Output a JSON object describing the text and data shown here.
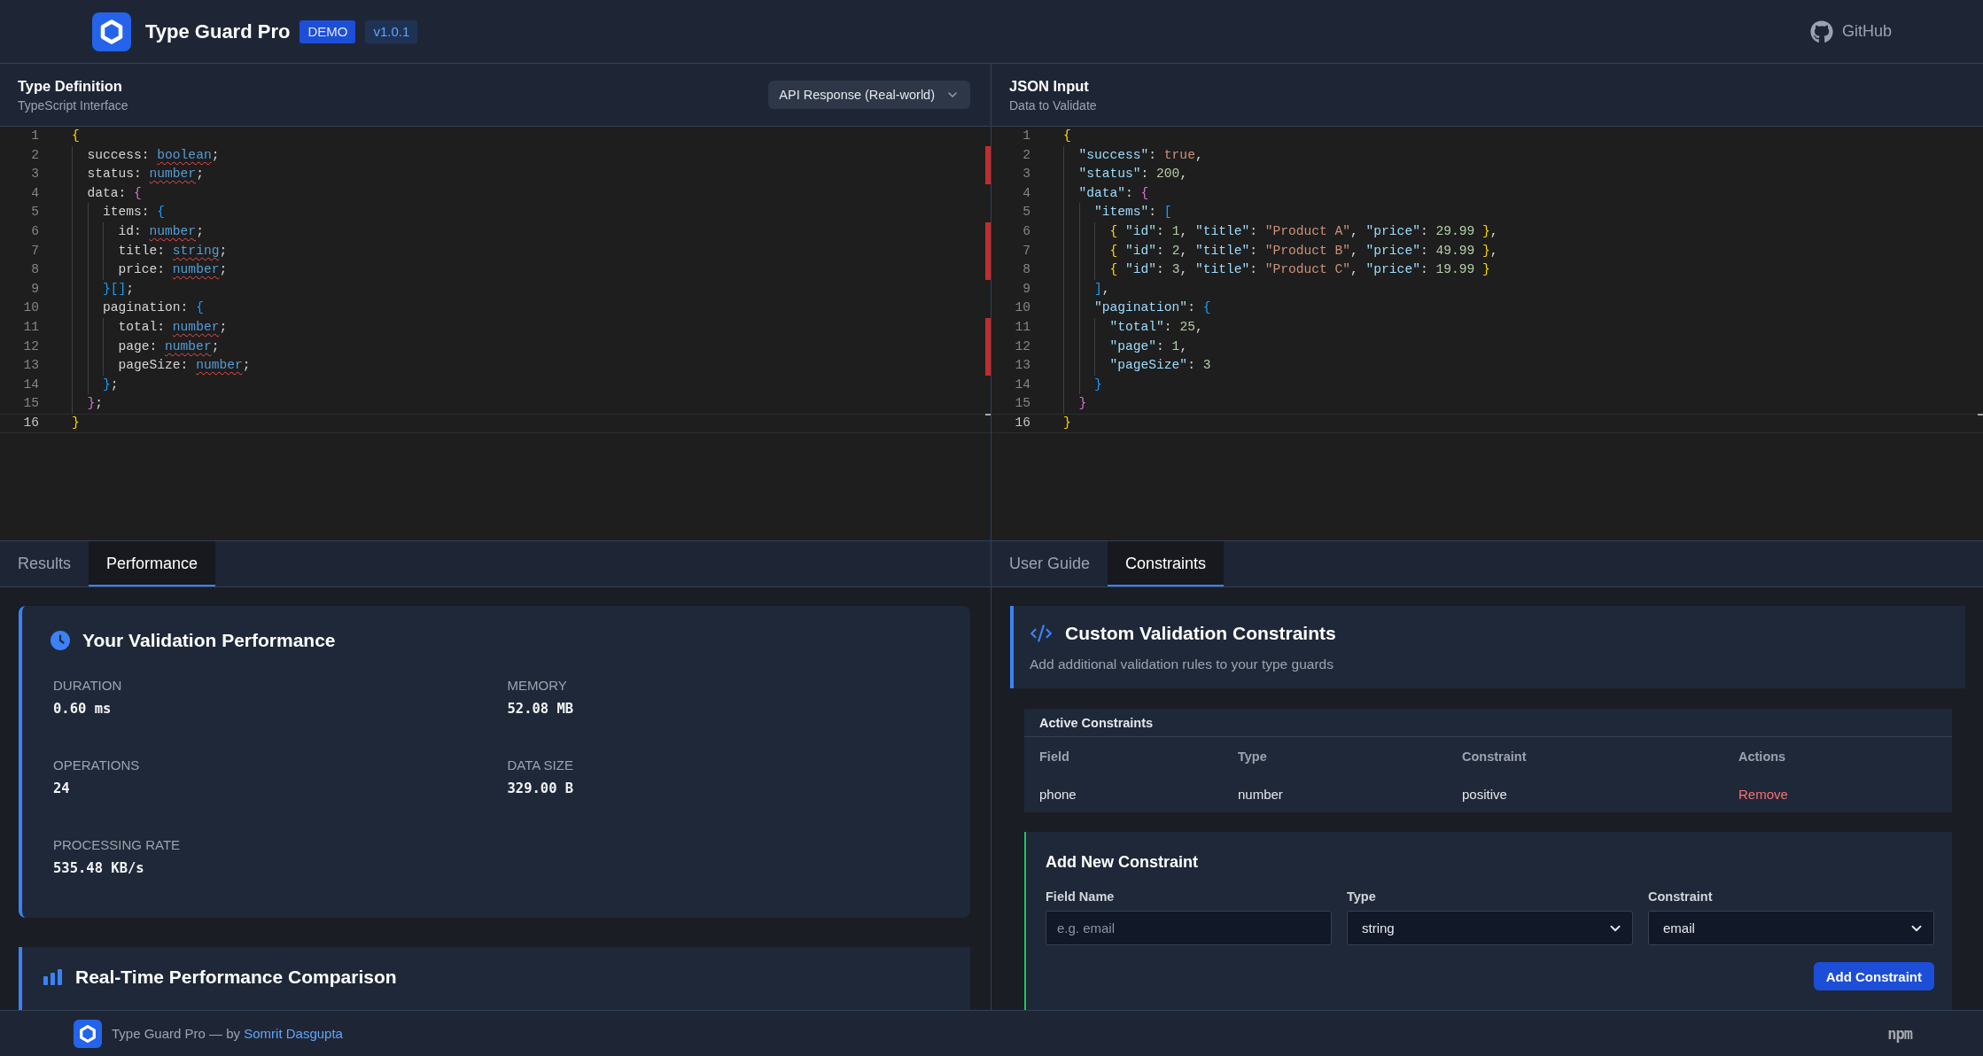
{
  "header": {
    "title": "Type Guard Pro",
    "badges": [
      {
        "kind": "demo",
        "text": "DEMO"
      },
      {
        "kind": "version",
        "text": "v1.0.1"
      }
    ],
    "github_link": "GitHub"
  },
  "editors": [
    {
      "title": "Type Definition",
      "subtitle": "TypeScript Interface",
      "preset_select": {
        "value": "API Response (Real-world)"
      },
      "lines": [
        {
          "number": "1",
          "current": false,
          "error": false,
          "tokens": [
            {
              "kind": "bracket1",
              "text": "{"
            }
          ]
        },
        {
          "number": "2",
          "current": false,
          "error": true,
          "tokens": [
            {
              "kind": "plain",
              "text": "  success: "
            },
            {
              "kind": "type",
              "text": "boolean"
            },
            {
              "kind": "plain",
              "text": ";"
            }
          ]
        },
        {
          "number": "3",
          "current": false,
          "error": true,
          "tokens": [
            {
              "kind": "plain",
              "text": "  status: "
            },
            {
              "kind": "type",
              "text": "number"
            },
            {
              "kind": "plain",
              "text": ";"
            }
          ]
        },
        {
          "number": "4",
          "current": false,
          "error": false,
          "tokens": [
            {
              "kind": "plain",
              "text": "  data: "
            },
            {
              "kind": "bracket2",
              "text": "{"
            }
          ]
        },
        {
          "number": "5",
          "current": false,
          "error": false,
          "tokens": [
            {
              "kind": "plain",
              "text": "    items: "
            },
            {
              "kind": "bracket3",
              "text": "{"
            }
          ]
        },
        {
          "number": "6",
          "current": false,
          "error": true,
          "tokens": [
            {
              "kind": "plain",
              "text": "      id: "
            },
            {
              "kind": "type",
              "text": "number"
            },
            {
              "kind": "plain",
              "text": ";"
            }
          ]
        },
        {
          "number": "7",
          "current": false,
          "error": true,
          "tokens": [
            {
              "kind": "plain",
              "text": "      title: "
            },
            {
              "kind": "type",
              "text": "string"
            },
            {
              "kind": "plain",
              "text": ";"
            }
          ]
        },
        {
          "number": "8",
          "current": false,
          "error": true,
          "tokens": [
            {
              "kind": "plain",
              "text": "      price: "
            },
            {
              "kind": "type",
              "text": "number"
            },
            {
              "kind": "plain",
              "text": ";"
            }
          ]
        },
        {
          "number": "9",
          "current": false,
          "error": false,
          "tokens": [
            {
              "kind": "bracket3",
              "text": "    }[]"
            },
            {
              "kind": "plain",
              "text": ";"
            }
          ]
        },
        {
          "number": "10",
          "current": false,
          "error": false,
          "tokens": [
            {
              "kind": "plain",
              "text": "    pagination: "
            },
            {
              "kind": "bracket3",
              "text": "{"
            }
          ]
        },
        {
          "number": "11",
          "current": false,
          "error": true,
          "tokens": [
            {
              "kind": "plain",
              "text": "      total: "
            },
            {
              "kind": "type",
              "text": "number"
            },
            {
              "kind": "plain",
              "text": ";"
            }
          ]
        },
        {
          "number": "12",
          "current": false,
          "error": true,
          "tokens": [
            {
              "kind": "plain",
              "text": "      page: "
            },
            {
              "kind": "type",
              "text": "number"
            },
            {
              "kind": "plain",
              "text": ";"
            }
          ]
        },
        {
          "number": "13",
          "current": false,
          "error": true,
          "tokens": [
            {
              "kind": "plain",
              "text": "      pageSize: "
            },
            {
              "kind": "type",
              "text": "number"
            },
            {
              "kind": "plain",
              "text": ";"
            }
          ]
        },
        {
          "number": "14",
          "current": false,
          "error": false,
          "tokens": [
            {
              "kind": "bracket3",
              "text": "    }"
            },
            {
              "kind": "plain",
              "text": ";"
            }
          ]
        },
        {
          "number": "15",
          "current": false,
          "error": false,
          "tokens": [
            {
              "kind": "bracket2",
              "text": "  }"
            },
            {
              "kind": "plain",
              "text": ";"
            }
          ]
        },
        {
          "number": "16",
          "current": true,
          "error": false,
          "tokens": [
            {
              "kind": "bracket1",
              "text": "}"
            }
          ]
        }
      ]
    },
    {
      "title": "JSON Input",
      "subtitle": "Data to Validate",
      "lines": [
        {
          "number": "1",
          "current": false,
          "error": false,
          "tokens": [
            {
              "kind": "bracket1",
              "text": "{"
            }
          ]
        },
        {
          "number": "2",
          "current": false,
          "error": false,
          "tokens": [
            {
              "kind": "key",
              "text": "  \"success\""
            },
            {
              "kind": "plain",
              "text": ": "
            },
            {
              "kind": "bool",
              "text": "true"
            },
            {
              "kind": "plain",
              "text": ","
            }
          ]
        },
        {
          "number": "3",
          "current": false,
          "error": false,
          "tokens": [
            {
              "kind": "key",
              "text": "  \"status\""
            },
            {
              "kind": "plain",
              "text": ": "
            },
            {
              "kind": "number",
              "text": "200"
            },
            {
              "kind": "plain",
              "text": ","
            }
          ]
        },
        {
          "number": "4",
          "current": false,
          "error": false,
          "tokens": [
            {
              "kind": "key",
              "text": "  \"data\""
            },
            {
              "kind": "plain",
              "text": ": "
            },
            {
              "kind": "bracket2",
              "text": "{"
            }
          ]
        },
        {
          "number": "5",
          "current": false,
          "error": false,
          "tokens": [
            {
              "kind": "key",
              "text": "    \"items\""
            },
            {
              "kind": "plain",
              "text": ": "
            },
            {
              "kind": "bracket3",
              "text": "["
            }
          ]
        },
        {
          "number": "6",
          "current": false,
          "error": false,
          "tokens": [
            {
              "kind": "bracket1",
              "text": "      {"
            },
            {
              "kind": "key",
              "text": " \"id\""
            },
            {
              "kind": "plain",
              "text": ": "
            },
            {
              "kind": "number",
              "text": "1"
            },
            {
              "kind": "plain",
              "text": ", "
            },
            {
              "kind": "key",
              "text": "\"title\""
            },
            {
              "kind": "plain",
              "text": ": "
            },
            {
              "kind": "string",
              "text": "\"Product A\""
            },
            {
              "kind": "plain",
              "text": ", "
            },
            {
              "kind": "key",
              "text": "\"price\""
            },
            {
              "kind": "plain",
              "text": ": "
            },
            {
              "kind": "number",
              "text": "29.99"
            },
            {
              "kind": "bracket1",
              "text": " }"
            },
            {
              "kind": "plain",
              "text": ","
            }
          ]
        },
        {
          "number": "7",
          "current": false,
          "error": false,
          "tokens": [
            {
              "kind": "bracket1",
              "text": "      {"
            },
            {
              "kind": "key",
              "text": " \"id\""
            },
            {
              "kind": "plain",
              "text": ": "
            },
            {
              "kind": "number",
              "text": "2"
            },
            {
              "kind": "plain",
              "text": ", "
            },
            {
              "kind": "key",
              "text": "\"title\""
            },
            {
              "kind": "plain",
              "text": ": "
            },
            {
              "kind": "string",
              "text": "\"Product B\""
            },
            {
              "kind": "plain",
              "text": ", "
            },
            {
              "kind": "key",
              "text": "\"price\""
            },
            {
              "kind": "plain",
              "text": ": "
            },
            {
              "kind": "number",
              "text": "49.99"
            },
            {
              "kind": "bracket1",
              "text": " }"
            },
            {
              "kind": "plain",
              "text": ","
            }
          ]
        },
        {
          "number": "8",
          "current": false,
          "error": false,
          "tokens": [
            {
              "kind": "bracket1",
              "text": "      {"
            },
            {
              "kind": "key",
              "text": " \"id\""
            },
            {
              "kind": "plain",
              "text": ": "
            },
            {
              "kind": "number",
              "text": "3"
            },
            {
              "kind": "plain",
              "text": ", "
            },
            {
              "kind": "key",
              "text": "\"title\""
            },
            {
              "kind": "plain",
              "text": ": "
            },
            {
              "kind": "string",
              "text": "\"Product C\""
            },
            {
              "kind": "plain",
              "text": ", "
            },
            {
              "kind": "key",
              "text": "\"price\""
            },
            {
              "kind": "plain",
              "text": ": "
            },
            {
              "kind": "number",
              "text": "19.99"
            },
            {
              "kind": "bracket1",
              "text": " }"
            }
          ]
        },
        {
          "number": "9",
          "current": false,
          "error": false,
          "tokens": [
            {
              "kind": "bracket3",
              "text": "    ]"
            },
            {
              "kind": "plain",
              "text": ","
            }
          ]
        },
        {
          "number": "10",
          "current": false,
          "error": false,
          "tokens": [
            {
              "kind": "key",
              "text": "    \"pagination\""
            },
            {
              "kind": "plain",
              "text": ": "
            },
            {
              "kind": "bracket3",
              "text": "{"
            }
          ]
        },
        {
          "number": "11",
          "current": false,
          "error": false,
          "tokens": [
            {
              "kind": "key",
              "text": "      \"total\""
            },
            {
              "kind": "plain",
              "text": ": "
            },
            {
              "kind": "number",
              "text": "25"
            },
            {
              "kind": "plain",
              "text": ","
            }
          ]
        },
        {
          "number": "12",
          "current": false,
          "error": false,
          "tokens": [
            {
              "kind": "key",
              "text": "      \"page\""
            },
            {
              "kind": "plain",
              "text": ": "
            },
            {
              "kind": "number",
              "text": "1"
            },
            {
              "kind": "plain",
              "text": ","
            }
          ]
        },
        {
          "number": "13",
          "current": false,
          "error": false,
          "tokens": [
            {
              "kind": "key",
              "text": "      \"pageSize\""
            },
            {
              "kind": "plain",
              "text": ": "
            },
            {
              "kind": "number",
              "text": "3"
            }
          ]
        },
        {
          "number": "14",
          "current": false,
          "error": false,
          "tokens": [
            {
              "kind": "bracket3",
              "text": "    }"
            }
          ]
        },
        {
          "number": "15",
          "current": false,
          "error": false,
          "tokens": [
            {
              "kind": "bracket2",
              "text": "  }"
            }
          ]
        },
        {
          "number": "16",
          "current": true,
          "error": false,
          "tokens": [
            {
              "kind": "bracket1",
              "text": "}"
            }
          ]
        }
      ]
    }
  ],
  "performance_pane": {
    "tabs": [
      {
        "label": "Results",
        "selected": false
      },
      {
        "label": "Performance",
        "selected": true
      }
    ],
    "performance_card": {
      "title": "Your Validation Performance",
      "metrics": [
        {
          "label": "DURATION",
          "value": "0.60 ms"
        },
        {
          "label": "MEMORY",
          "value": "52.08 MB"
        },
        {
          "label": "OPERATIONS",
          "value": "24"
        },
        {
          "label": "DATA SIZE",
          "value": "329.00 B"
        },
        {
          "label": "PROCESSING RATE",
          "value": "535.48 KB/s"
        }
      ]
    },
    "comparison_card": {
      "title": "Real-Time Performance Comparison"
    }
  },
  "constraints_pane": {
    "tabs": [
      {
        "label": "User Guide",
        "selected": false
      },
      {
        "label": "Constraints",
        "selected": true
      }
    ],
    "intro_card": {
      "title": "Custom Validation Constraints",
      "subtitle": "Add additional validation rules to your type guards"
    },
    "active_constraints": {
      "title": "Active Constraints",
      "columns": [
        "Field",
        "Type",
        "Constraint",
        "Actions"
      ],
      "rows": [
        {
          "field": "phone",
          "type": "number",
          "constraint": "positive",
          "action": "Remove"
        }
      ]
    },
    "add_form": {
      "title": "Add New Constraint",
      "fields": [
        {
          "kind": "input",
          "label": "Field Name",
          "placeholder": "e.g. email"
        },
        {
          "kind": "select",
          "label": "Type",
          "value": "string"
        },
        {
          "kind": "select",
          "label": "Constraint",
          "value": "email"
        }
      ],
      "button": "Add Constraint"
    }
  },
  "footer": {
    "credit": "Type Guard Pro — by",
    "author_link": "Somrit Dasgupta",
    "npm_link": "npm"
  }
}
